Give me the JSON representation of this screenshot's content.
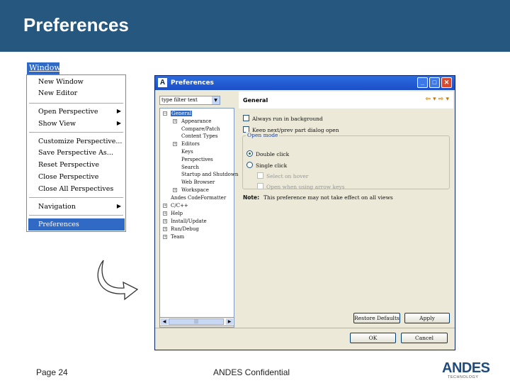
{
  "slide": {
    "title": "Preferences",
    "page": "Page 24",
    "confidential": "ANDES Confidential"
  },
  "logo": {
    "word": "ANDES",
    "sub": "TECHNOLOGY"
  },
  "menu": {
    "title": "Window",
    "items": [
      {
        "label": "New Window",
        "submenu": false
      },
      {
        "label": "New Editor",
        "submenu": false
      },
      {
        "label": "Open Perspective",
        "submenu": true
      },
      {
        "label": "Show View",
        "submenu": true
      },
      {
        "label": "Customize Perspective...",
        "submenu": false
      },
      {
        "label": "Save Perspective As...",
        "submenu": false
      },
      {
        "label": "Reset Perspective",
        "submenu": false
      },
      {
        "label": "Close Perspective",
        "submenu": false
      },
      {
        "label": "Close All Perspectives",
        "submenu": false
      },
      {
        "label": "Navigation",
        "submenu": true
      },
      {
        "label": "Preferences",
        "submenu": false,
        "selected": true
      }
    ],
    "arrow_glyph": "▶"
  },
  "dialog": {
    "title": "Preferences",
    "app_icon": "A",
    "window_buttons": {
      "minimize": "_",
      "maximize": "□",
      "close": "✕"
    },
    "filter_placeholder": "type filter text",
    "filter_arrow": "▼",
    "tree": [
      {
        "label": "General",
        "selected": true,
        "expander": "−"
      },
      {
        "label": "Appearance",
        "expander": "+"
      },
      {
        "label": "Compare/Patch"
      },
      {
        "label": "Content Types"
      },
      {
        "label": "Editors",
        "expander": "+"
      },
      {
        "label": "Keys"
      },
      {
        "label": "Perspectives"
      },
      {
        "label": "Search"
      },
      {
        "label": "Startup and Shutdown"
      },
      {
        "label": "Web Browser"
      },
      {
        "label": "Workspace",
        "expander": "+"
      },
      {
        "label": "Andes CodeFormatter"
      },
      {
        "label": "C/C++",
        "expander": "+"
      },
      {
        "label": "Help",
        "expander": "+"
      },
      {
        "label": "Install/Update",
        "expander": "+"
      },
      {
        "label": "Run/Debug",
        "expander": "+"
      },
      {
        "label": "Team",
        "expander": "+"
      }
    ],
    "scroll": {
      "left": "◀",
      "right": "▶",
      "thumb": "|||"
    },
    "panel": {
      "heading": "General",
      "nav": "⇦ ▾ ⇨ ▾",
      "checkbox1": "Always run in background",
      "checkbox2": "Keep next/prev part dialog open",
      "open_mode_title": "Open mode",
      "radio_double": "Double click",
      "radio_single": "Single click",
      "select_hover": "Select on hover",
      "open_arrow": "Open when using arrow keys",
      "note_label": "Note:",
      "note_text": "This preference may not take effect on all views"
    },
    "buttons": {
      "restore": "Restore Defaults",
      "apply": "Apply",
      "ok": "OK",
      "cancel": "Cancel"
    }
  }
}
